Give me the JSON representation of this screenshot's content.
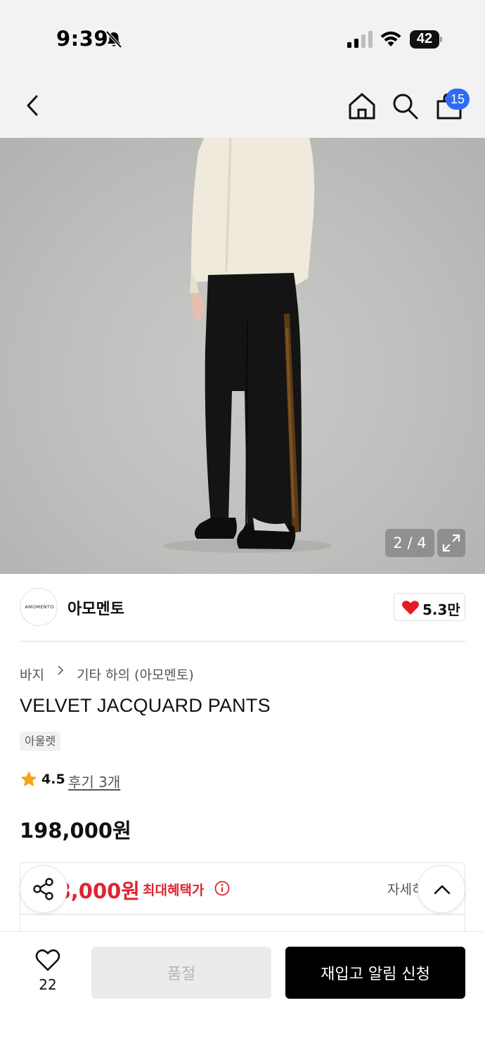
{
  "status_bar": {
    "time": "9:39",
    "battery": "42"
  },
  "nav": {
    "cart_badge": "15"
  },
  "gallery": {
    "counter": "2 / 4"
  },
  "brand": {
    "logo_text": "AMOMENTO",
    "name": "아모멘토",
    "like_count": "5.3만"
  },
  "breadcrumb": {
    "category": "바지",
    "subcategory": "기타 하의 (아모멘토)"
  },
  "product": {
    "title": "VELVET JACQUARD PANTS",
    "tag": "아울렛",
    "rating": "4.5",
    "review_link": "후기 3개",
    "price": "198,000원"
  },
  "benefit": {
    "price": "198,000원",
    "label": "최대혜택가",
    "detail": "자세히"
  },
  "bottom_bar": {
    "wish_count": "22",
    "soldout_label": "품절",
    "restock_label": "재입고 알림 신청"
  },
  "colors": {
    "accent_red": "#e0242f",
    "badge_blue": "#2d6cf5",
    "heart_red": "#e41b23",
    "star_orange": "#f7a21b"
  },
  "icons": [
    "bell-slash-icon",
    "signal-icon",
    "wifi-icon",
    "battery-icon",
    "back-arrow-icon",
    "home-icon",
    "search-icon",
    "shopping-bag-icon",
    "expand-icon",
    "heart-icon",
    "chevron-right-icon",
    "star-icon",
    "info-icon",
    "share-icon",
    "chevron-up-icon",
    "heart-outline-icon"
  ]
}
